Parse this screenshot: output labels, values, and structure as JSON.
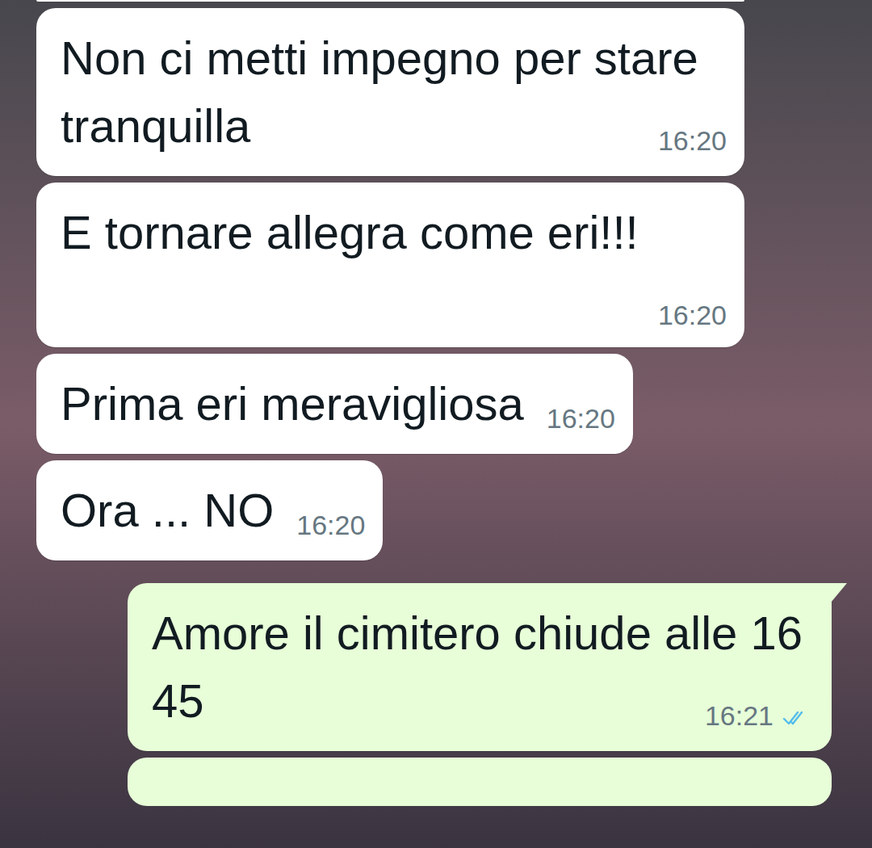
{
  "messages": [
    {
      "direction": "in",
      "text": "Non ci metti impegno per stare tranquilla",
      "time": "16:20"
    },
    {
      "direction": "in",
      "text": "E tornare allegra come eri!!!",
      "time": "16:20"
    },
    {
      "direction": "in",
      "text": "Prima eri meravigliosa",
      "time": "16:20"
    },
    {
      "direction": "in",
      "text": "Ora ... NO",
      "time": "16:20"
    },
    {
      "direction": "out",
      "text": "Amore il cimitero chiude alle 16 45",
      "time": "16:21",
      "status": "read"
    }
  ]
}
